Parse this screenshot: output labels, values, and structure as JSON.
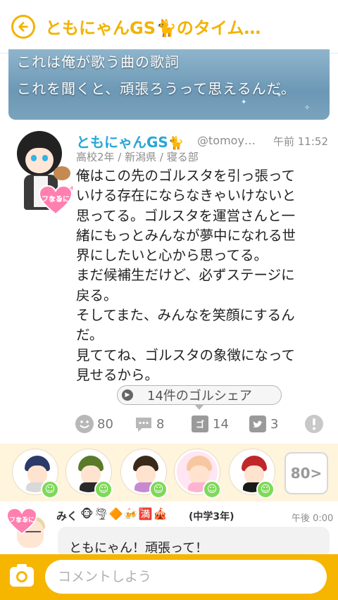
{
  "header": {
    "title": "ともにゃんGS🐈のタイム…"
  },
  "banner": {
    "line1": "これは俺が歌う曲の歌詞",
    "line2": "これを聞くと、頑張ろうって思えるんだ。"
  },
  "post": {
    "author_name": "ともにゃんGS",
    "author_emoji": "🐈",
    "handle": "@tomoy…",
    "time": "午前 11:52",
    "meta": "高校2年 / 新潟県 / 寝る部",
    "fan_badge": [
      "ファンに",
      "なる"
    ],
    "body_lines": [
      "俺はこの先のゴルスタを引っ張って",
      "いける存在にならなきゃいけないと",
      "思ってる。ゴルスタを運営さんと一",
      "緒にもっとみんなが夢中になれる世",
      "界にしたいと心から思ってる。",
      "まだ候補生だけど、必ずステージに",
      "戻る。",
      "そしてまた、みんなを笑顔にするん",
      "だ。",
      "見ててね、ゴルスタの象徴になって",
      "見せるから。"
    ],
    "share_label": "14件のゴルシェア"
  },
  "actions": {
    "like_count": "80",
    "comment_count": "8",
    "share_count": "14",
    "tweet_count": "3"
  },
  "fans": {
    "more_label": "80>"
  },
  "comment": {
    "name": "みく",
    "emojis": "🐵🌪🔶🍻🈵🎪",
    "grade": "(中学3年)",
    "time": "午後 0:00",
    "fan_badge": [
      "ファンに",
      "なる"
    ],
    "text": "ともにゃん！頑張って！"
  },
  "composer": {
    "placeholder": "コメントしよう"
  },
  "colors": {
    "accent": "#f6b600",
    "name_blue": "#2aa6d4",
    "fan_pink": "#ff7fb0",
    "badge_green": "#7ed957"
  }
}
